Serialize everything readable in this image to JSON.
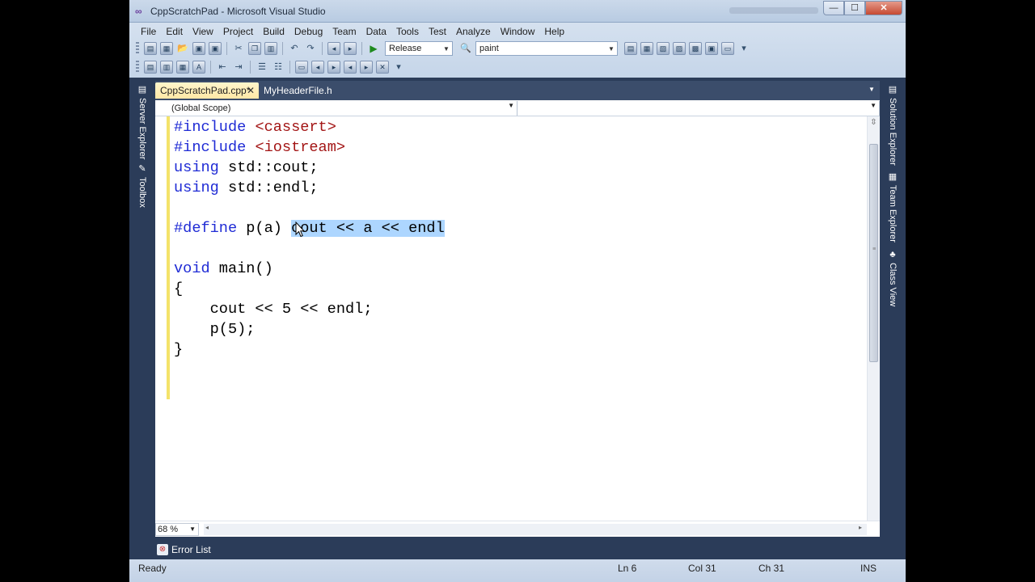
{
  "window": {
    "title": "CppScratchPad - Microsoft Visual Studio",
    "min_glyph": "—",
    "max_glyph": "☐",
    "close_glyph": "✕"
  },
  "menu": [
    "File",
    "Edit",
    "View",
    "Project",
    "Build",
    "Debug",
    "Team",
    "Data",
    "Tools",
    "Test",
    "Analyze",
    "Window",
    "Help"
  ],
  "toolbar": {
    "configuration": "Release",
    "find_text": "paint"
  },
  "side_panels": {
    "left": [
      "Server Explorer",
      "Toolbox"
    ],
    "right": [
      "Solution Explorer",
      "Team Explorer",
      "Class View"
    ]
  },
  "tabs": {
    "active": "CppScratchPad.cpp*",
    "inactive": "MyHeaderFile.h"
  },
  "navigation": {
    "scope": "(Global Scope)",
    "member": ""
  },
  "code": {
    "line1_kw": "#include",
    "line1_str": "<cassert>",
    "line2_kw": "#include",
    "line2_str": "<iostream>",
    "line3_kw": "using",
    "line3_rest": " std::cout;",
    "line4_kw": "using",
    "line4_rest": " std::endl;",
    "line6_kw": "#define",
    "line6_plain": " p(a) ",
    "line6_sel": "cout << a << endl",
    "line8_kw": "void",
    "line8_rest": " main()",
    "line9": "{",
    "line10": "    cout << 5 << endl;",
    "line11": "    p(5);",
    "line12": "}"
  },
  "zoom": "68 %",
  "bottom_tab": "Error List",
  "status": {
    "state": "Ready",
    "line": "Ln 6",
    "col": "Col 31",
    "ch": "Ch 31",
    "mode": "INS"
  },
  "colors": {
    "keyword": "#1f2bd5",
    "string": "#a31515",
    "selection": "#add6ff",
    "change_marker": "#f4e36a",
    "active_tab": "#ffe8a6"
  }
}
